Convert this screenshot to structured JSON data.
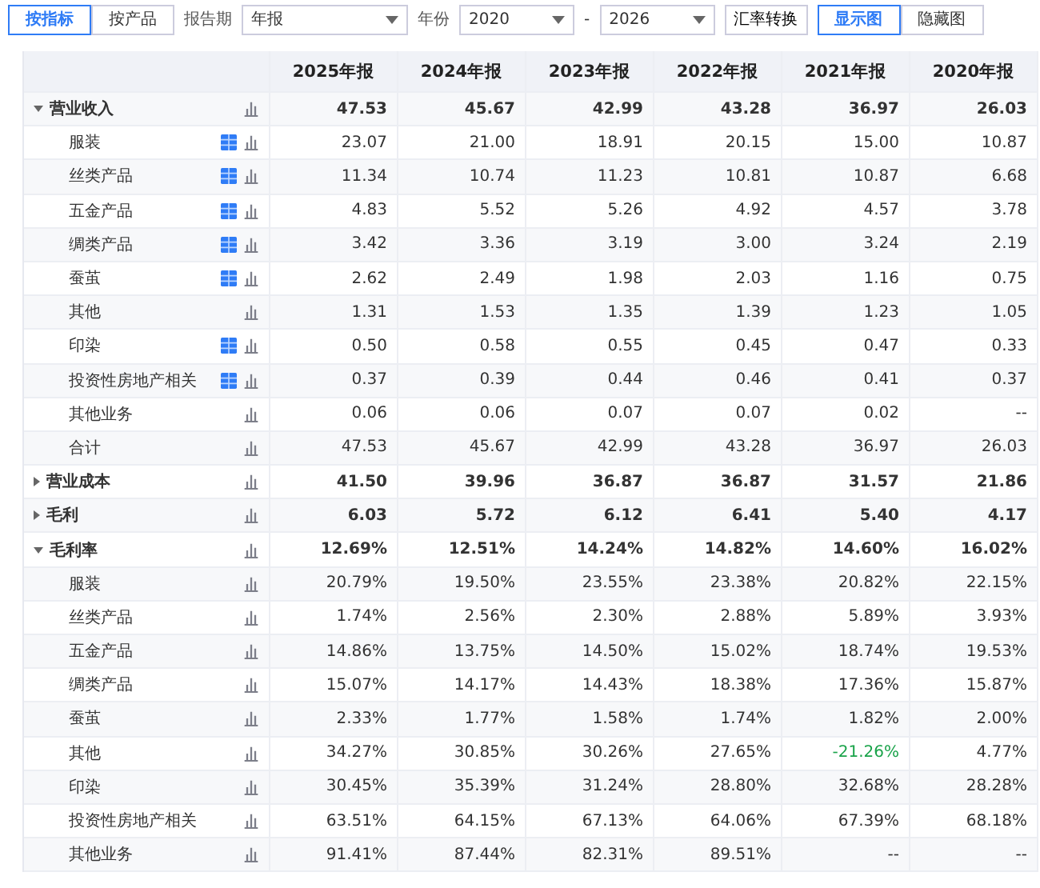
{
  "toolbar": {
    "view_tabs": [
      {
        "label": "按指标",
        "selected": true
      },
      {
        "label": "按产品",
        "selected": false
      }
    ],
    "period_label": "报告期",
    "period_select": "年报",
    "year_label": "年份",
    "year_from": "2020",
    "year_separator": "-",
    "year_to": "2026",
    "fx_button": "汇率转换",
    "chart_tabs": [
      {
        "label": "显示图",
        "selected": true
      },
      {
        "label": "隐藏图",
        "selected": false
      }
    ]
  },
  "table": {
    "columns": [
      "2025年报",
      "2024年报",
      "2023年报",
      "2022年报",
      "2021年报",
      "2020年报"
    ],
    "rows": [
      {
        "label": "营业收入",
        "expanded": true,
        "values": [
          "47.53",
          "45.67",
          "42.99",
          "43.28",
          "36.97",
          "26.03"
        ],
        "children": [
          {
            "label": "服装",
            "table_icon": true,
            "values": [
              "23.07",
              "21.00",
              "18.91",
              "20.15",
              "15.00",
              "10.87"
            ]
          },
          {
            "label": "丝类产品",
            "table_icon": true,
            "values": [
              "11.34",
              "10.74",
              "11.23",
              "10.81",
              "10.87",
              "6.68"
            ]
          },
          {
            "label": "五金产品",
            "table_icon": true,
            "values": [
              "4.83",
              "5.52",
              "5.26",
              "4.92",
              "4.57",
              "3.78"
            ]
          },
          {
            "label": "绸类产品",
            "table_icon": true,
            "values": [
              "3.42",
              "3.36",
              "3.19",
              "3.00",
              "3.24",
              "2.19"
            ]
          },
          {
            "label": "蚕茧",
            "table_icon": true,
            "values": [
              "2.62",
              "2.49",
              "1.98",
              "2.03",
              "1.16",
              "0.75"
            ]
          },
          {
            "label": "其他",
            "table_icon": false,
            "values": [
              "1.31",
              "1.53",
              "1.35",
              "1.39",
              "1.23",
              "1.05"
            ]
          },
          {
            "label": "印染",
            "table_icon": true,
            "values": [
              "0.50",
              "0.58",
              "0.55",
              "0.45",
              "0.47",
              "0.33"
            ]
          },
          {
            "label": "投资性房地产相关",
            "table_icon": true,
            "values": [
              "0.37",
              "0.39",
              "0.44",
              "0.46",
              "0.41",
              "0.37"
            ]
          },
          {
            "label": "其他业务",
            "table_icon": false,
            "values": [
              "0.06",
              "0.06",
              "0.07",
              "0.07",
              "0.02",
              "--"
            ]
          },
          {
            "label": "合计",
            "table_icon": false,
            "values": [
              "47.53",
              "45.67",
              "42.99",
              "43.28",
              "36.97",
              "26.03"
            ]
          }
        ]
      },
      {
        "label": "营业成本",
        "expanded": false,
        "values": [
          "41.50",
          "39.96",
          "36.87",
          "36.87",
          "31.57",
          "21.86"
        ]
      },
      {
        "label": "毛利",
        "expanded": false,
        "values": [
          "6.03",
          "5.72",
          "6.12",
          "6.41",
          "5.40",
          "4.17"
        ]
      },
      {
        "label": "毛利率",
        "expanded": true,
        "values": [
          "12.69%",
          "12.51%",
          "14.24%",
          "14.82%",
          "14.60%",
          "16.02%"
        ],
        "children": [
          {
            "label": "服装",
            "table_icon": false,
            "values": [
              "20.79%",
              "19.50%",
              "23.55%",
              "23.38%",
              "20.82%",
              "22.15%"
            ]
          },
          {
            "label": "丝类产品",
            "table_icon": false,
            "values": [
              "1.74%",
              "2.56%",
              "2.30%",
              "2.88%",
              "5.89%",
              "3.93%"
            ]
          },
          {
            "label": "五金产品",
            "table_icon": false,
            "values": [
              "14.86%",
              "13.75%",
              "14.50%",
              "15.02%",
              "18.74%",
              "19.53%"
            ]
          },
          {
            "label": "绸类产品",
            "table_icon": false,
            "values": [
              "15.07%",
              "14.17%",
              "14.43%",
              "18.38%",
              "17.36%",
              "15.87%"
            ]
          },
          {
            "label": "蚕茧",
            "table_icon": false,
            "values": [
              "2.33%",
              "1.77%",
              "1.58%",
              "1.74%",
              "1.82%",
              "2.00%"
            ]
          },
          {
            "label": "其他",
            "table_icon": false,
            "values": [
              "34.27%",
              "30.85%",
              "30.26%",
              "27.65%",
              "-21.26%",
              "4.77%"
            ],
            "negative": [
              false,
              false,
              false,
              false,
              true,
              false
            ]
          },
          {
            "label": "印染",
            "table_icon": false,
            "values": [
              "30.45%",
              "35.39%",
              "31.24%",
              "28.80%",
              "32.68%",
              "28.28%"
            ]
          },
          {
            "label": "投资性房地产相关",
            "table_icon": false,
            "values": [
              "63.51%",
              "64.15%",
              "67.13%",
              "64.06%",
              "67.39%",
              "68.18%"
            ]
          },
          {
            "label": "其他业务",
            "table_icon": false,
            "values": [
              "91.41%",
              "87.44%",
              "82.31%",
              "89.51%",
              "--",
              "--"
            ]
          }
        ]
      }
    ]
  }
}
